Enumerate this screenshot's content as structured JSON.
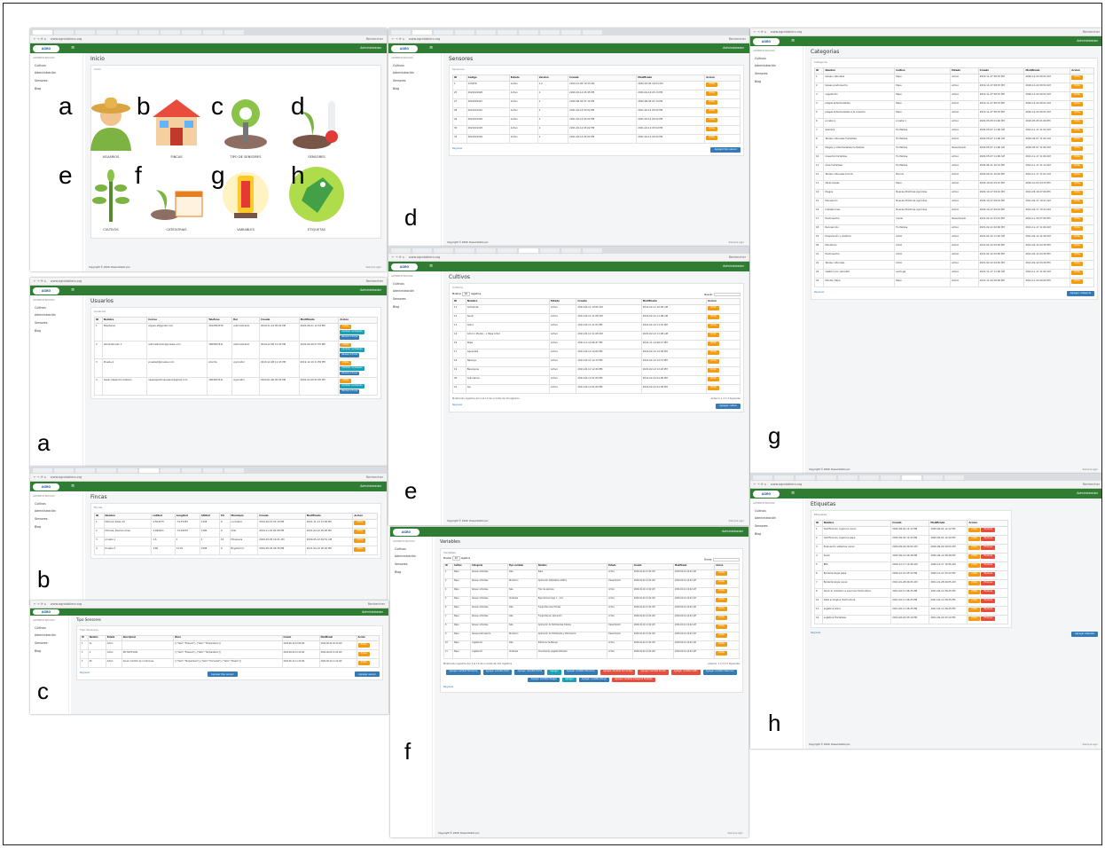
{
  "common": {
    "url": "www.agrotablero.org",
    "search": "Rechercher",
    "admin": "Administrador",
    "sidebar_header": "ADMINISTRACION",
    "sidebar": [
      "Cultivos",
      "Administración",
      "Sensores",
      "Blog"
    ],
    "home": "Inicio",
    "copyright": "Copyright © 2020.",
    "developed": "Desarrollado por",
    "agro": "Siempre agro",
    "regresar": "Regresar"
  },
  "panel_inicio": {
    "title": "Inicio",
    "card": "Inicio",
    "tiles": [
      {
        "l": "a",
        "label": "USUARIOS"
      },
      {
        "l": "b",
        "label": "FINCAS"
      },
      {
        "l": "c",
        "label": "TIPO DE SENSORES"
      },
      {
        "l": "d",
        "label": "SENSORES"
      },
      {
        "l": "e",
        "label": "CULTIVOS"
      },
      {
        "l": "f",
        "label": "CATEGORIAS"
      },
      {
        "l": "g",
        "label": "VARIABLES"
      },
      {
        "l": "h",
        "label": "ETIQUETAS"
      }
    ]
  },
  "panel_letters": {
    "a": "a",
    "b": "b",
    "c": "c",
    "d": "d",
    "e": "e",
    "f": "f",
    "g": "g",
    "h": "h"
  },
  "usuarios": {
    "title": "Usuarios",
    "card": "Usuarios",
    "headers": [
      "ID",
      "Nombre",
      "Correo",
      "Telefono",
      "Rol",
      "Creado",
      "Modificado",
      "Accion"
    ],
    "rows": [
      [
        "1",
        "Stephanie",
        "stypeo.sf@gmail.com",
        "3012564376",
        "Administrador",
        "2019-11-19 05:04 PM",
        "2020-08-21 12:34 PM"
      ],
      [
        "2",
        "Administrador 1",
        "administrador@prueba.com",
        "3005657411",
        "Administrador",
        "2019-12-08 11:43 PM",
        "2020-04-30 07:35 PM"
      ],
      [
        "3",
        "Prueba 2",
        "prueba2@prueba.com",
        "Ahorita",
        "Agricultor",
        "2019-12-08 11:43 PM",
        "2019-12-10 11:58 PM"
      ],
      [
        "4",
        "Cesar Alejandro Arellano",
        "cesarlejandroarellano@gmail.com",
        "3004567411",
        "Agricultor",
        "2020-01-06 05:05 PM",
        "2020-01-06 05:05 PM"
      ]
    ],
    "b1": "Editar",
    "b2": "Cambiar contraseña",
    "b3": "Revisar a fincas"
  },
  "fincas": {
    "title": "Fincas",
    "card": "Fincas",
    "headers": [
      "ID",
      "Nombre",
      "Latitud",
      "Longitud",
      "Altitud",
      "Pd",
      "Municipio",
      "Creado",
      "Modificado",
      "Accion"
    ],
    "rows": [
      [
        "1",
        "Mariano Salas 10",
        "4.504275",
        "-74.07287",
        "1108",
        "6",
        "La Calera",
        "2019-10-10 03:10 PM",
        "2021-11-13 12:06 PM"
      ],
      [
        "2",
        "Molinas, Buenos Aires",
        "4.490201",
        "-74.02070",
        "1180",
        "6",
        "Villa",
        "2019-11-20 02:08 PM",
        "2021-04-12 05:26 PM"
      ],
      [
        "3",
        "prueba 1",
        "1.6",
        "1",
        "1",
        "10",
        "Mosquera",
        "2020-03-05 10:21 AM",
        "2020-05-12 02:51 AM"
      ],
      [
        "4",
        "Prueba 3",
        "4.60",
        "74.01",
        "1598",
        "6",
        "Bogotá D.C.",
        "2020-05-03 06:36 PM",
        "2021-04-12 05:26 PM"
      ]
    ],
    "b1": "Editar"
  },
  "tipos": {
    "title": "Tipo Sensores",
    "card": "Tipo Sensores",
    "headers": [
      "ID",
      "Nombre",
      "Estado",
      "Descripción",
      "Nivel",
      "Creado",
      "Modificado",
      "Accion"
    ],
    "rows": [
      [
        "1",
        "AL",
        "Activo",
        "",
        "[{\"Valor\":\"Pressure\"},{\"Valor\":\"Temperature\"}]",
        "2020-06-10 10:08 AM",
        "2020-06-29 02:10 AM"
      ],
      [
        "2",
        "2",
        "Activo",
        "KB-720FP-9201",
        "[{\"Valor\":\"Pressure\"},{\"Valor\":\"Temperature\"}]",
        "2020-06-09 10:20 AM",
        "2020-06-09 10:20 AM"
      ],
      [
        "3",
        "RC",
        "Activo",
        "Sensor medidor de condiciones",
        "[{\"Valor\":\"Temperatura\"},{\"Valor\":\"Humedad\"},{\"Valor\":\"Presión\"}]",
        "2020-06-12 11:10 AM",
        "2020-06-12 11:10 AM"
      ]
    ],
    "b1": "Editar",
    "add": "Agregar tipo sensor",
    "add2": "Agregar sensor"
  },
  "sensores": {
    "title": "Sensores",
    "card": "Sensores",
    "headers": [
      "ID",
      "Codigo",
      "Estado",
      "Version",
      "Creado",
      "Modificado",
      "Accion"
    ],
    "rows": [
      [
        "1",
        "123456",
        "Activo",
        "1.2",
        "2019-12-06 10:33 AM",
        "2020-03-06 10:03 AM"
      ],
      [
        "25",
        "2022021628",
        "Activo",
        "1",
        "2020-02-14 03:45 PM",
        "2020-04-16 03:13 PM"
      ],
      [
        "27",
        "2022083427",
        "Activo",
        "1",
        "2020-08-04 07:14 PM",
        "2020-08-04 07:14 PM"
      ],
      [
        "28",
        "2021021201",
        "Activo",
        "1",
        "2021-02-12 03:02 PM",
        "2021-02-12 03:02 PM"
      ],
      [
        "29",
        "2021021202",
        "Activo",
        "1",
        "2021-02-12 03:02 PM",
        "2021-02-12 03:02 PM"
      ],
      [
        "30",
        "2021021203",
        "Activo",
        "1",
        "2021-02-12 03:02 PM",
        "2021-02-12 03:02 PM"
      ],
      [
        "31",
        "2021021204",
        "Activo",
        "1",
        "2021-02-12 03:02 PM",
        "2021-02-12 03:02 PM"
      ]
    ],
    "b1": "Editar",
    "add": "Agregar tipo sensor"
  },
  "cultivos": {
    "title": "Cultivos",
    "card": "Cultivos",
    "show": "Mostrar",
    "entries": "10",
    "registros": "registros",
    "buscar": "Buscar:",
    "headers": [
      "ID",
      "Nombre",
      "Estado",
      "Creado",
      "Modificado",
      "Accion"
    ],
    "rows": [
      [
        "11",
        "Ambiente",
        "Activo",
        "2021-02-11 10:05 AM",
        "2021-02-11 10:05 AM"
      ],
      [
        "12",
        "Suelo",
        "Activo",
        "2021-02-12 11:08 AM",
        "2021-02-12 11:08 AM"
      ],
      [
        "13",
        "Árbol",
        "Activo",
        "2021-02-12 11:01 PM",
        "2021-02-12 11:01 PM"
      ],
      [
        "14",
        "Árbol o Planta - o Papa Árbol",
        "Activo",
        "2021-02-12 11:08 AM",
        "2021-02-12 11:08 AM"
      ],
      [
        "16",
        "Papa",
        "Activo",
        "2021-11-14 06:47 PM",
        "2021-11-14 06:47 PM"
      ],
      [
        "17",
        "Aguacate",
        "Activo",
        "2021-02-12 12:09 PM",
        "2021-02-12 12:09 PM"
      ],
      [
        "18",
        "Naranja",
        "Activo",
        "2021-02-12 12:13 PM",
        "2021-02-12 12:13 PM"
      ],
      [
        "19",
        "Berenjena",
        "Activo",
        "2021-02-12 12:20 PM",
        "2021-02-12 12:20 PM"
      ],
      [
        "20",
        "Arándanos",
        "Activo",
        "2021-02-12 01:09 PM",
        "2021-02-12 01:09 PM"
      ],
      [
        "21",
        "Ajo",
        "Activo",
        "2021-02-12 01:09 PM",
        "2021-02-12 01:09 PM"
      ]
    ],
    "info": "Mostrando registros del 1 al 10 de un total de 30 registros",
    "prev": "Anterior",
    "pages": [
      "1",
      "2",
      "3",
      "4"
    ],
    "next": "Siguiente",
    "b1": "Editar",
    "add": "Agregar cultivo"
  },
  "categorias": {
    "title": "Categorias",
    "card": "Categoria",
    "headers": [
      "ID",
      "Nombre",
      "Cultivo",
      "Estado",
      "Creado",
      "Modificado",
      "Accion"
    ],
    "rows": [
      [
        "1",
        "tareas culturales",
        "Papa",
        "Activo",
        "2019-11-27 08:33 PM",
        "2020-12-22 09:52 AM"
      ],
      [
        "2",
        "tareas postcosecha",
        "Papa",
        "Activo",
        "2019-11-27 08:33 PM",
        "2020-12-22 09:52 AM"
      ],
      [
        "3",
        "vegetación",
        "Papa",
        "Activo",
        "2019-11-27 08:33 PM",
        "2020-12-22 09:52 AM"
      ],
      [
        "4",
        "plagas enfermedades",
        "Papa",
        "Activo",
        "2019-11-27 08:33 PM",
        "2020-12-22 09:52 AM"
      ],
      [
        "5",
        "plagas enfermedades a la cosecha",
        "Papa",
        "Activo",
        "2019-11-27 08:33 PM",
        "2020-12-22 09:52 AM"
      ],
      [
        "6",
        "prueba 1",
        "prueba 1",
        "Activo",
        "2020-05-05 01:06 PM",
        "2020-05-05 01:06 PM"
      ],
      [
        "7",
        "Siembra",
        "Hortalizas",
        "Activo",
        "2020-05-07 11:06 AM",
        "2021-11-17 11:52 AM"
      ],
      [
        "8",
        "Tareas culturales hortalizas",
        "Hortalizas",
        "Activo",
        "2020-05-07 11:06 AM",
        "2020-05-07 11:06 AM"
      ],
      [
        "9",
        "Plagas y enfermedades hortalizas",
        "Hortalizas",
        "Desactivado",
        "2020-05-07 11:06 AM",
        "2020-05-07 11:06 AM"
      ],
      [
        "10",
        "Cosecha hortalizas",
        "Hortalizas",
        "Activo",
        "2020-05-07 11:06 AM",
        "2021-11-17 11:06 AM"
      ],
      [
        "11",
        "Área hortalizas",
        "Hortalizas",
        "Activo",
        "2020-06-11 10:14 PM",
        "2021-11-17 11:14 AM"
      ],
      [
        "12",
        "Tareas culturales brocoli",
        "Brocoli",
        "Activo",
        "2020-09-11 10:02 PM",
        "2021-11-17 11:02 AM"
      ],
      [
        "13",
        "Otras tareas",
        "Papa",
        "Activo",
        "2020-10-02 04:15 PM",
        "2020-10-02 04:15 PM"
      ],
      [
        "14",
        "Riegos",
        "Buenas Prácticas Agrícolas",
        "Activo",
        "2020-10-17 09:24 PM",
        "2021-03-16 07:06 PM"
      ],
      [
        "15",
        "Planeación",
        "Buenas Prácticas Agrícolas",
        "Activo",
        "2020-10-17 09:24 PM",
        "2021-02-17 10:21 AM"
      ],
      [
        "16",
        "Instalaciones",
        "Buenas Prácticas Agrícolas",
        "Activo",
        "2020-10-17 09:24 PM",
        "2021-02-17 10:23 AM"
      ],
      [
        "17",
        "Postcosecha",
        "Cacao",
        "Desactivado",
        "2021-02-11 01:01 PM",
        "2021-11-30 07:06 PM"
      ],
      [
        "18",
        "Recolección",
        "Hortalizas",
        "Activo",
        "2021-02-11 02:06 PM",
        "2021-11-17 11:06 AM"
      ],
      [
        "19",
        "Preparación y siembra",
        "Árbol",
        "Activo",
        "2021-02-12 11:26 AM",
        "2021-02-12 11:26 AM"
      ],
      [
        "20",
        "Monitoreo",
        "Árbol",
        "Activo",
        "2021-02-12 04:36 PM",
        "2021-02-12 04:36 PM"
      ],
      [
        "21",
        "Postcosecha",
        "Árbol",
        "Activo",
        "2021-02-12 04:36 PM",
        "2021-02-12 04:36 PM"
      ],
      [
        "22",
        "Tareas culturales",
        "Árbol",
        "Activo",
        "2021-02-12 04:36 PM",
        "2021-02-12 04:36 PM"
      ],
      [
        "23",
        "Gestión por variedad",
        "Lechuga",
        "Activo",
        "2021-11-17 11:06 AM",
        "2021-11-17 11:06 AM"
      ],
      [
        "24",
        "Monitor Papa",
        "Papa",
        "Activo",
        "2021-11-24 09:06 PM",
        "2021-11-24 09:06 PM"
      ]
    ],
    "b1": "Editar",
    "add": "Agregar categoría"
  },
  "variables": {
    "title": "Variables",
    "card": "Variables",
    "show": "Mostrar",
    "entries": "10",
    "registros": "registros",
    "buscar": "Buscar:",
    "headers": [
      "ID",
      "Cultivo",
      "Categoria",
      "Tipo variable",
      "Nombre",
      "Estado",
      "Creado",
      "Modificado",
      "Accion"
    ],
    "rows": [
      [
        "1",
        "Papa",
        "tareas culturales",
        "Sale",
        "Papa",
        "Activo",
        "2020-04-14 12:42 AM",
        "2020-04-14 12:42 AM"
      ],
      [
        "2",
        "Papa",
        "tareas culturales",
        "Numérico",
        "Aplicación fertilizante edáfico",
        "Desactivado",
        "2020-04-14 12:42 AM",
        "2020-04-14 12:42 AM"
      ],
      [
        "4",
        "Papa",
        "tareas culturales",
        "Sale",
        "Tipo de aporque",
        "Activo",
        "2020-04-14 12:42 AM",
        "2020-04-14 12:42 AM"
      ],
      [
        "5",
        "Papa",
        "tareas culturales",
        "Unidades",
        "Bajo lámina riego 1 - 1cm",
        "Activo",
        "2020-04-14 12:42 AM",
        "2020-04-14 12:42 AM"
      ],
      [
        "6",
        "Papa",
        "tareas culturales",
        "Sale",
        "Fungicidas insecticidas",
        "Activo",
        "2020-04-14 12:42 AM",
        "2020-04-14 12:42 AM"
      ],
      [
        "7",
        "Papa",
        "tareas culturales",
        "Sale",
        "Fungicidas en aplicación",
        "Activo",
        "2020-04-14 12:42 AM",
        "2020-04-14 12:42 AM"
      ],
      [
        "8",
        "Papa",
        "tareas culturales",
        "Sale",
        "Aplicación de fertilizantes foliares",
        "Desactivado",
        "2020-04-14 12:42 AM",
        "2020-04-14 12:42 AM"
      ],
      [
        "9",
        "Papa",
        "tareas postcosecha",
        "Numérico",
        "Aplicación de Fertilizante y Polinización",
        "Desactivado",
        "2020-04-14 12:42 AM",
        "2020-04-14 12:42 AM"
      ],
      [
        "10",
        "Papa",
        "vegetación",
        "Sale",
        "Prácticas de Manejo",
        "Activo",
        "2020-04-14 12:42 AM",
        "2020-04-14 12:42 AM"
      ],
      [
        "11",
        "Papa",
        "vegetación",
        "Unidades",
        "Crecimiento vegetal Diámetro",
        "Activo",
        "2020-04-14 12:42 AM",
        "2020-04-14 12:42 AM"
      ]
    ],
    "info": "Mostrando registros del 1 al 10 de un total de 110 registros",
    "prev": "Anterior",
    "pages": [
      "1",
      "2",
      "3",
      "4",
      "5"
    ],
    "next": "Siguiente",
    "b1": "Editar",
    "buttons": [
      {
        "t": "Agregar variable Numérica",
        "c": "#337ab7"
      },
      {
        "t": "Agregar variable Texto",
        "c": "#337ab7"
      },
      {
        "t": "Agregar variable Fecha",
        "c": "#337ab7"
      },
      {
        "t": "Agregar",
        "c": "#17a2b8"
      },
      {
        "t": "Agregar variable Ubicación",
        "c": "#337ab7"
      },
      {
        "t": "Agregar variable Porcentaje",
        "c": "#e74c3c"
      },
      {
        "t": "Agregar variable Escala",
        "c": "#e74c3c"
      },
      {
        "t": "Agregar variable Sí/No",
        "c": "#e74c3c"
      },
      {
        "t": "Agregar variable Selección",
        "c": "#337ab7"
      },
      {
        "t": "Agregar variable Imagen",
        "c": "#337ab7"
      },
      {
        "t": "Agregar",
        "c": "#17a2b8"
      },
      {
        "t": "Agregar variable Rango",
        "c": "#337ab7"
      },
      {
        "t": "Agregar variable Categoría Multiple",
        "c": "#e74c3c"
      }
    ]
  },
  "etiquetas": {
    "title": "Etiquetas",
    "card": "Etiquetas",
    "headers": [
      "ID",
      "Nombre",
      "Creado",
      "Modificado",
      "Accion"
    ],
    "rows": [
      [
        "1",
        "Certificación orgánica cacao",
        "2020-09-02 12:12 PM",
        "2020-09-02 12:12 PM"
      ],
      [
        "2",
        "Certificación orgánica papa",
        "2020-09-02 12:20 PM",
        "2020-09-02 12:20 PM"
      ],
      [
        "3",
        "Evaluación sistemas cacao",
        "2020-09-02 09:00 AM",
        "2020-09-02 09:00 AM"
      ],
      [
        "4",
        "Suelo",
        "2020-09-14 06:28 PM",
        "2020-09-14 06:28 PM"
      ],
      [
        "5",
        "BPA",
        "2020-12-17 10:36 AM",
        "2020-12-17 10:36 AM"
      ],
      [
        "6",
        "Epidemiología papa",
        "2020-12-21 05:22 PM",
        "2020-12-21 05:22 PM"
      ],
      [
        "7",
        "Epidemiología cacao",
        "2021-01-28 09:05 AM",
        "2021-01-28 09:05 AM"
      ],
      [
        "8",
        "Servicio climático e insumos Horticultura",
        "2021-02-11 06:25 PM",
        "2021-02-11 06:25 PM"
      ],
      [
        "10",
        "Salla ecológica Horticultura",
        "2021-02-11 06:25 PM",
        "2021-02-11 06:25 PM"
      ],
      [
        "11",
        "Logística árbol",
        "2021-02-11 06:25 PM",
        "2021-02-11 06:25 PM"
      ],
      [
        "12",
        "Logística Hortalizas",
        "2021-02-22 03:10 PM",
        "2021-02-22 03:10 PM"
      ]
    ],
    "b1": "Editar",
    "b2": "Eliminar",
    "add": "Agregar etiqueta"
  }
}
